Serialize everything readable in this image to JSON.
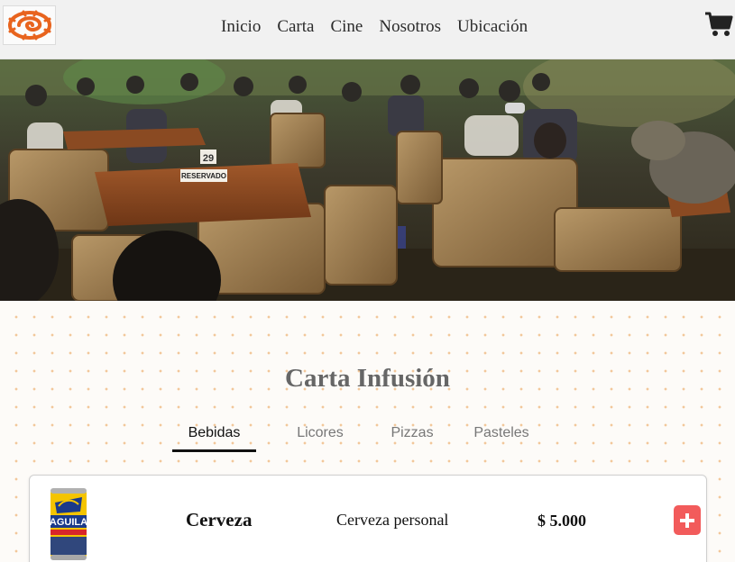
{
  "header": {
    "logo_icon": "swirl-logo-icon",
    "nav": [
      "Inicio",
      "Carta",
      "Cine",
      "Nosotros",
      "Ubicación"
    ],
    "cart_icon": "shopping-cart-icon"
  },
  "hero": {
    "table_number": "29",
    "table_sign": "RESERVADO"
  },
  "menu": {
    "title": "Carta Infusión",
    "tabs": [
      "Bebidas",
      "Licores",
      "Pizzas",
      "Pasteles"
    ],
    "active_tab": "Bebidas",
    "items": [
      {
        "name": "Cerveza",
        "description": "Cerveza personal",
        "price": "$ 5.000",
        "image_label": "AGUILA",
        "add_icon": "plus-icon"
      }
    ]
  },
  "colors": {
    "accent": "#f25b5b",
    "logo": "#e8641e",
    "dots": "#f2c79a"
  }
}
